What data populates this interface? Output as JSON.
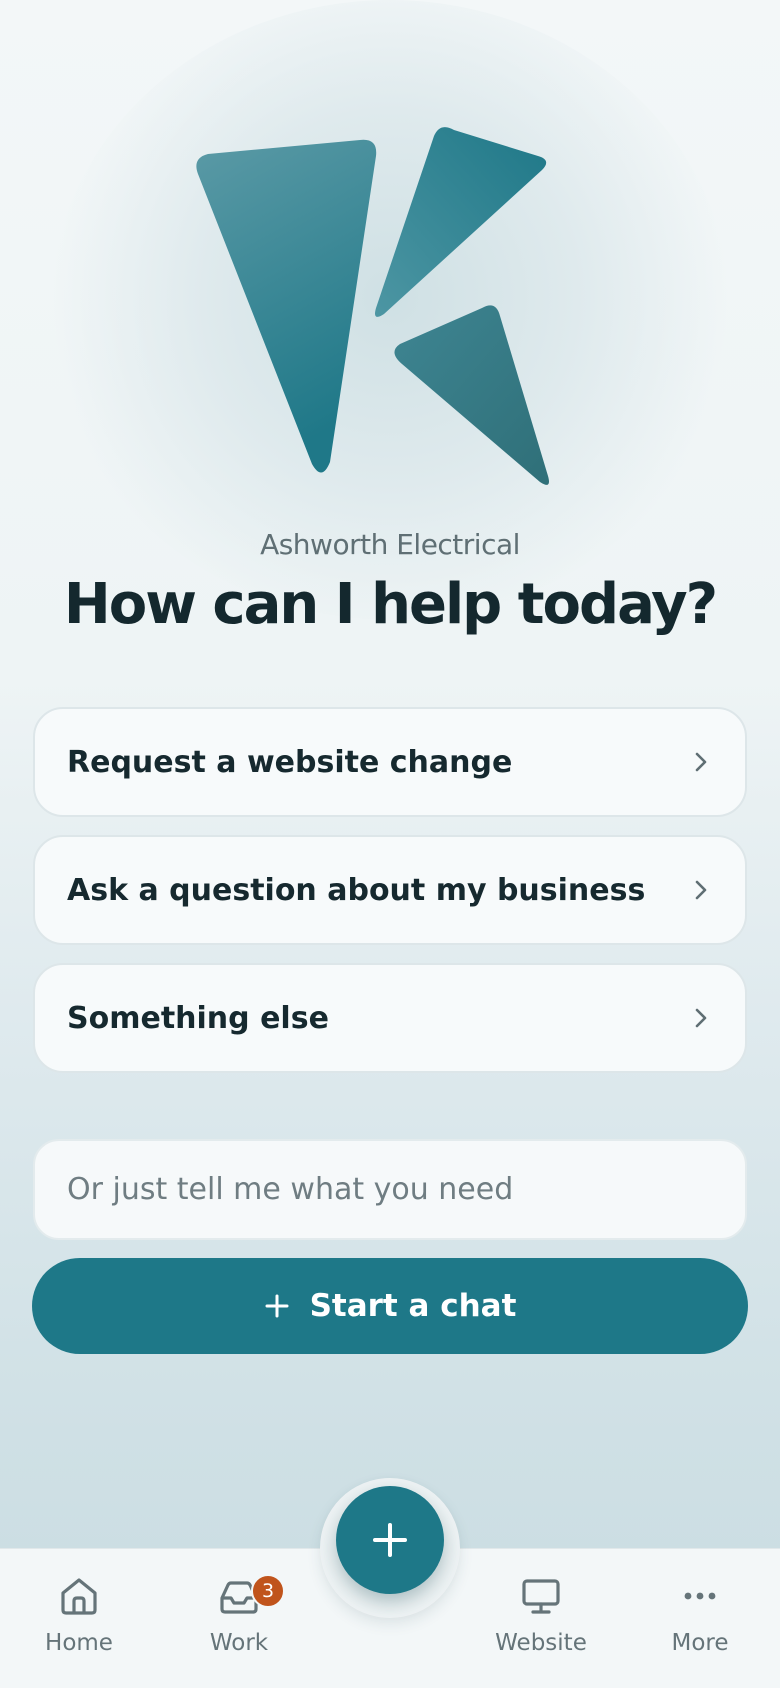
{
  "business_name": "Ashworth Electrical",
  "headline": "How can I help today?",
  "options": [
    {
      "label": "Request a website change"
    },
    {
      "label": "Ask a question about my business"
    },
    {
      "label": "Something else"
    }
  ],
  "input": {
    "placeholder": "Or just tell me what you need"
  },
  "start_chat": {
    "label": "Start a chat",
    "icon": "plus-icon"
  },
  "fab": {
    "icon": "plus-icon"
  },
  "tabs": [
    {
      "label": "Home",
      "icon": "home-icon"
    },
    {
      "label": "Work",
      "icon": "inbox-icon",
      "badge": "3"
    },
    {
      "label": "Website",
      "icon": "monitor-icon"
    },
    {
      "label": "More",
      "icon": "more-icon"
    }
  ],
  "colors": {
    "accent": "#1e7888",
    "badge": "#c0541c",
    "text": "#14282e",
    "muted": "#657479"
  }
}
